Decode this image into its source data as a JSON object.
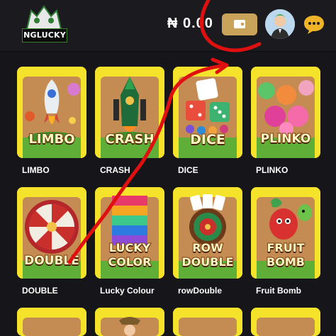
{
  "header": {
    "logo_text": "NGLUCKY",
    "balance": "₦ 0.00"
  },
  "games": [
    {
      "title_art": "LIMBO",
      "label": "LIMBO"
    },
    {
      "title_art": "CRASH",
      "label": "CRASH"
    },
    {
      "title_art": "DICE",
      "label": "DICE"
    },
    {
      "title_art": "PLINKO",
      "label": "PLINKO"
    },
    {
      "title_art": "DOUBLE",
      "label": "DOUBLE"
    },
    {
      "title_art_line1": "LUCKY",
      "title_art_line2": "COLOR",
      "label": "Lucky Colour"
    },
    {
      "title_art_line1": "ROW",
      "title_art_line2": "DOUBLE",
      "label": "rowDouble"
    },
    {
      "title_art_line1": "FRUIT",
      "title_art_line2": "BOMB",
      "label": "Fruit Bomb"
    }
  ],
  "colors": {
    "wallet": "#c9a35a",
    "card_bg": "#f2e126",
    "annotation": "#e01010"
  }
}
